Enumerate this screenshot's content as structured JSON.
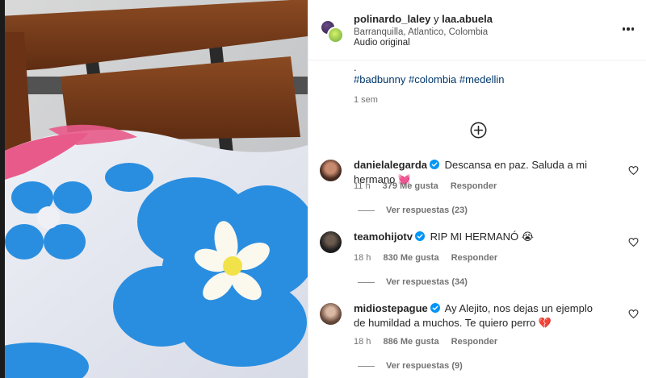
{
  "post": {
    "author": "polinardo_laley",
    "joiner": "y",
    "coauthor": "laa.abuela",
    "location": "Barranquilla, Atlantico, Colombia",
    "audio": "Audio original",
    "more_icon": "more-horizontal-icon"
  },
  "caption": {
    "dot": ".",
    "hashtags": [
      "#badbunny",
      "#colombia",
      "#medellin"
    ],
    "time": "1 sem"
  },
  "load_more_icon": "plus-circle-icon",
  "comments": [
    {
      "user": "danielalegarda",
      "verified": true,
      "text": "Descansa en paz. Saluda a mi hermano 💓",
      "time": "11 h",
      "likes": "379 Me gusta",
      "reply": "Responder",
      "view_replies": "Ver respuestas (23)"
    },
    {
      "user": "teamohijotv",
      "verified": true,
      "text": "RIP MI HERMANÓ 😭",
      "time": "18 h",
      "likes": "830 Me gusta",
      "reply": "Responder",
      "view_replies": "Ver respuestas (34)"
    },
    {
      "user": "midiostepague",
      "verified": true,
      "text": "Ay Alejito, nos dejas un ejemplo de humildad a muchos. Te quiero perro 💔",
      "time": "18 h",
      "likes": "886 Me gusta",
      "reply": "Responder",
      "view_replies": "Ver respuestas (9)"
    }
  ],
  "colors": {
    "link": "#00376b",
    "verified": "#0095f6",
    "muted": "#737373",
    "text": "#262626"
  }
}
